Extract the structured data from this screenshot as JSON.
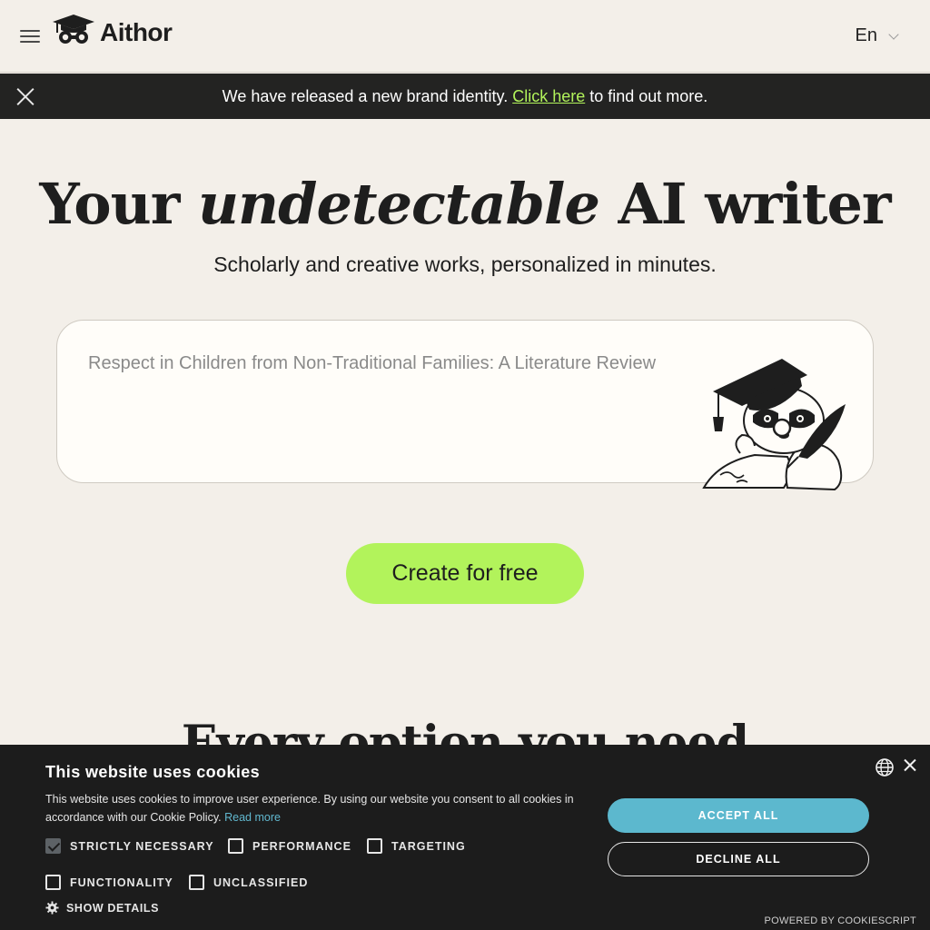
{
  "header": {
    "brand": "Aithor",
    "language": "En"
  },
  "banner": {
    "text_before": "We have released a new brand identity. ",
    "link": "Click here",
    "text_after": " to find out more."
  },
  "hero": {
    "title_part1": "Your ",
    "title_italic": "undetectable",
    "title_part2": " AI writer",
    "subtitle": "Scholarly and creative works, personalized in minutes.",
    "input_placeholder": "Respect in Children from Non-Traditional Families: A Literature Review",
    "cta_label": "Create for free"
  },
  "section": {
    "title": "Every option you need"
  },
  "cookie": {
    "title": "This website uses cookies",
    "text": "This website uses cookies to improve user experience. By using our website you consent to all cookies in accordance with our Cookie Policy.",
    "read_more": "Read more",
    "options": [
      {
        "label": "STRICTLY NECESSARY",
        "checked": true
      },
      {
        "label": "PERFORMANCE",
        "checked": false
      },
      {
        "label": "TARGETING",
        "checked": false
      },
      {
        "label": "FUNCTIONALITY",
        "checked": false
      },
      {
        "label": "UNCLASSIFIED",
        "checked": false
      }
    ],
    "show_details": "SHOW DETAILS",
    "accept_all": "ACCEPT ALL",
    "decline_all": "DECLINE ALL",
    "powered_by": "POWERED BY COOKIESCRIPT"
  },
  "colors": {
    "background": "#f3efe9",
    "accent_green": "#b2f35b",
    "banner_bg": "#232322",
    "cookie_bg": "#1c1c1c",
    "cookie_accent": "#5cb8ce"
  },
  "icons": [
    "menu-icon",
    "logo-mascot-icon",
    "chevron-down-icon",
    "close-icon",
    "globe-icon",
    "gear-icon"
  ]
}
